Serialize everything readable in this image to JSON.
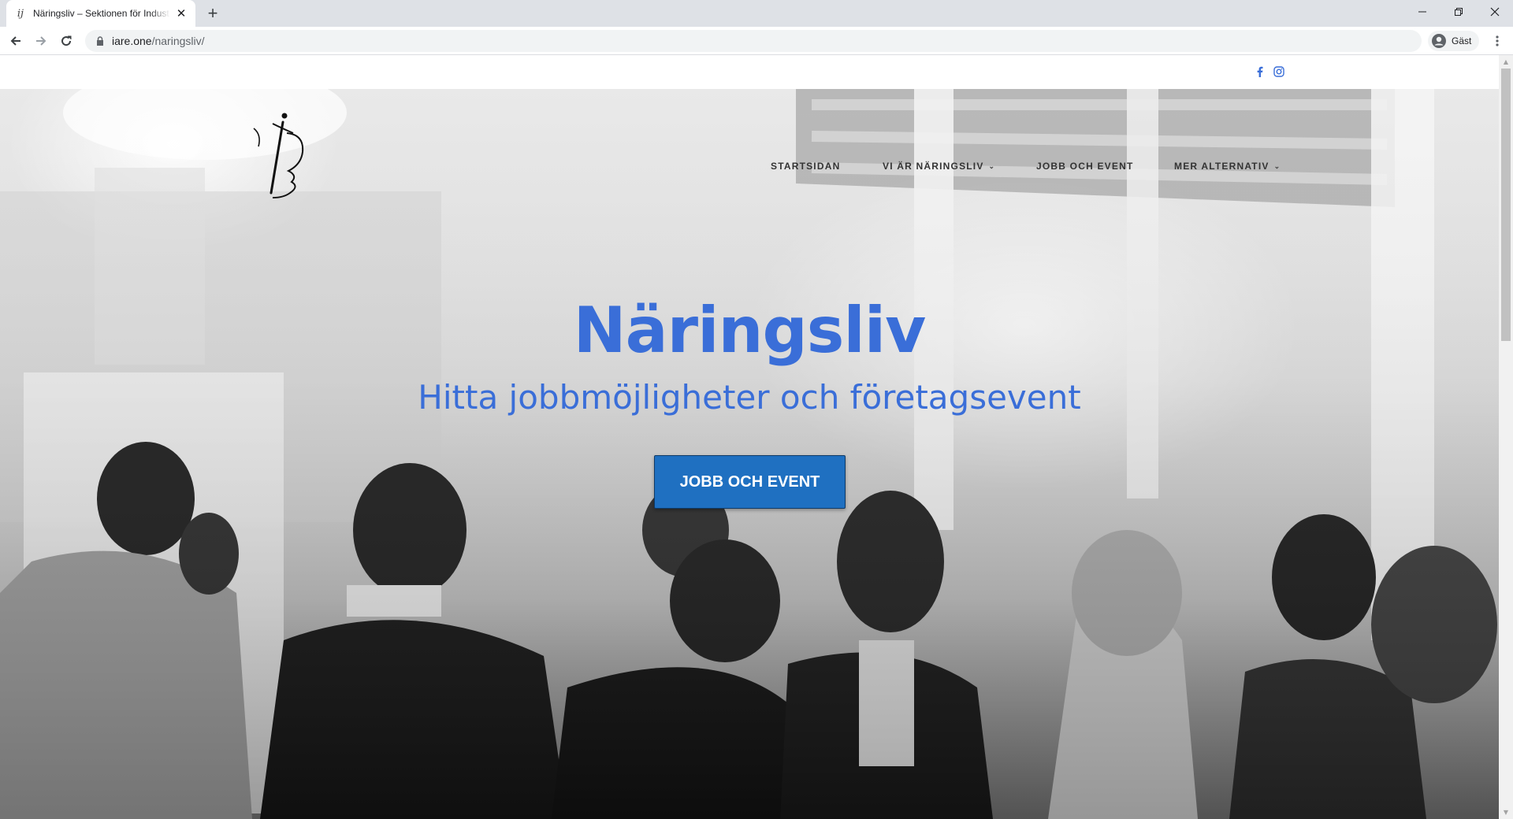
{
  "browser": {
    "tab_title": "Näringsliv – Sektionen för Industriell Arkitektur och Ekonomi",
    "favicon_glyph": "ij",
    "tab_close": "✕",
    "new_tab": "+",
    "url_host": "iare.one",
    "url_path": "/naringsliv/",
    "profile_name": "Gäst",
    "window_minimize": "—",
    "window_restore": "❐",
    "window_close": "✕"
  },
  "social": {
    "facebook_color": "#3a6ed8",
    "instagram_color": "#3a6ed8"
  },
  "nav": {
    "items": [
      {
        "label": "STARTSIDAN",
        "has_dropdown": false
      },
      {
        "label": "VI ÄR NÄRINGSLIV",
        "has_dropdown": true
      },
      {
        "label": "JOBB OCH EVENT",
        "has_dropdown": false
      },
      {
        "label": "MER ALTERNATIV",
        "has_dropdown": true
      }
    ],
    "caret": "⌄"
  },
  "hero": {
    "title": "Näringsliv",
    "subtitle": "Hitta jobbmöjligheter och företagsevent",
    "cta_label": "JOBB OCH EVENT",
    "accent_color": "#3a6ed8",
    "button_color": "#1f70c1"
  }
}
